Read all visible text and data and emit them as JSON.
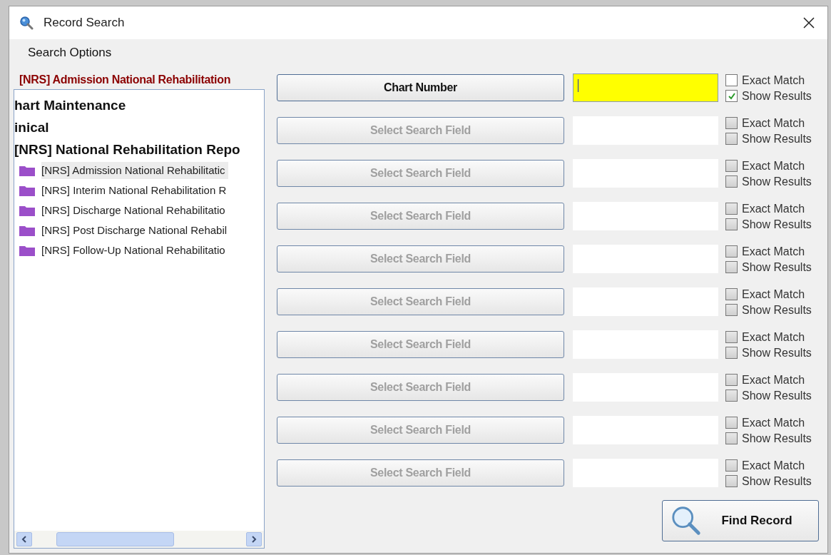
{
  "window": {
    "title": "Record Search"
  },
  "menu": [
    "Search Options"
  ],
  "form_title": "[NRS] Admission National Rehabilitation",
  "tree": [
    {
      "label": "hart Maintenance",
      "kind": "group",
      "selected": false
    },
    {
      "label": "inical",
      "kind": "group",
      "selected": false,
      "children": [
        {
          "label": "[NRS] National Rehabilitation Repo",
          "kind": "group",
          "selected": false,
          "children": [
            {
              "label": "[NRS] Admission National Rehabilitatic",
              "kind": "form",
              "selected": true
            },
            {
              "label": "[NRS] Interim National Rehabilitation R",
              "kind": "form",
              "selected": false
            },
            {
              "label": "[NRS] Discharge National Rehabilitatio",
              "kind": "form",
              "selected": false
            },
            {
              "label": "[NRS] Post Discharge National Rehabil",
              "kind": "form",
              "selected": false
            },
            {
              "label": "[NRS] Follow-Up National Rehabilitatio",
              "kind": "form",
              "selected": false
            }
          ]
        }
      ]
    }
  ],
  "search_rows": [
    {
      "field": "Chart Number",
      "disabled": false,
      "highlighted": true,
      "exact_match": false,
      "show_results": true,
      "exact_match_label": "Exact Match",
      "show_results_label": "Show Results"
    },
    {
      "field": "Select Search Field",
      "disabled": true,
      "highlighted": false,
      "exact_match": false,
      "show_results": false,
      "exact_match_label": "Exact Match",
      "show_results_label": "Show Results"
    },
    {
      "field": "Select Search Field",
      "disabled": true,
      "highlighted": false,
      "exact_match": false,
      "show_results": false,
      "exact_match_label": "Exact Match",
      "show_results_label": "Show Results"
    },
    {
      "field": "Select Search Field",
      "disabled": true,
      "highlighted": false,
      "exact_match": false,
      "show_results": false,
      "exact_match_label": "Exact Match",
      "show_results_label": "Show Results"
    },
    {
      "field": "Select Search Field",
      "disabled": true,
      "highlighted": false,
      "exact_match": false,
      "show_results": false,
      "exact_match_label": "Exact Match",
      "show_results_label": "Show Results"
    },
    {
      "field": "Select Search Field",
      "disabled": true,
      "highlighted": false,
      "exact_match": false,
      "show_results": false,
      "exact_match_label": "Exact Match",
      "show_results_label": "Show Results"
    },
    {
      "field": "Select Search Field",
      "disabled": true,
      "highlighted": false,
      "exact_match": false,
      "show_results": false,
      "exact_match_label": "Exact Match",
      "show_results_label": "Show Results"
    },
    {
      "field": "Select Search Field",
      "disabled": true,
      "highlighted": false,
      "exact_match": false,
      "show_results": false,
      "exact_match_label": "Exact Match",
      "show_results_label": "Show Results"
    },
    {
      "field": "Select Search Field",
      "disabled": true,
      "highlighted": false,
      "exact_match": false,
      "show_results": false,
      "exact_match_label": "Exact Match",
      "show_results_label": "Show Results"
    },
    {
      "field": "Select Search Field",
      "disabled": true,
      "highlighted": false,
      "exact_match": false,
      "show_results": false,
      "exact_match_label": "Exact Match",
      "show_results_label": "Show Results"
    }
  ],
  "find_button": "Find Record"
}
